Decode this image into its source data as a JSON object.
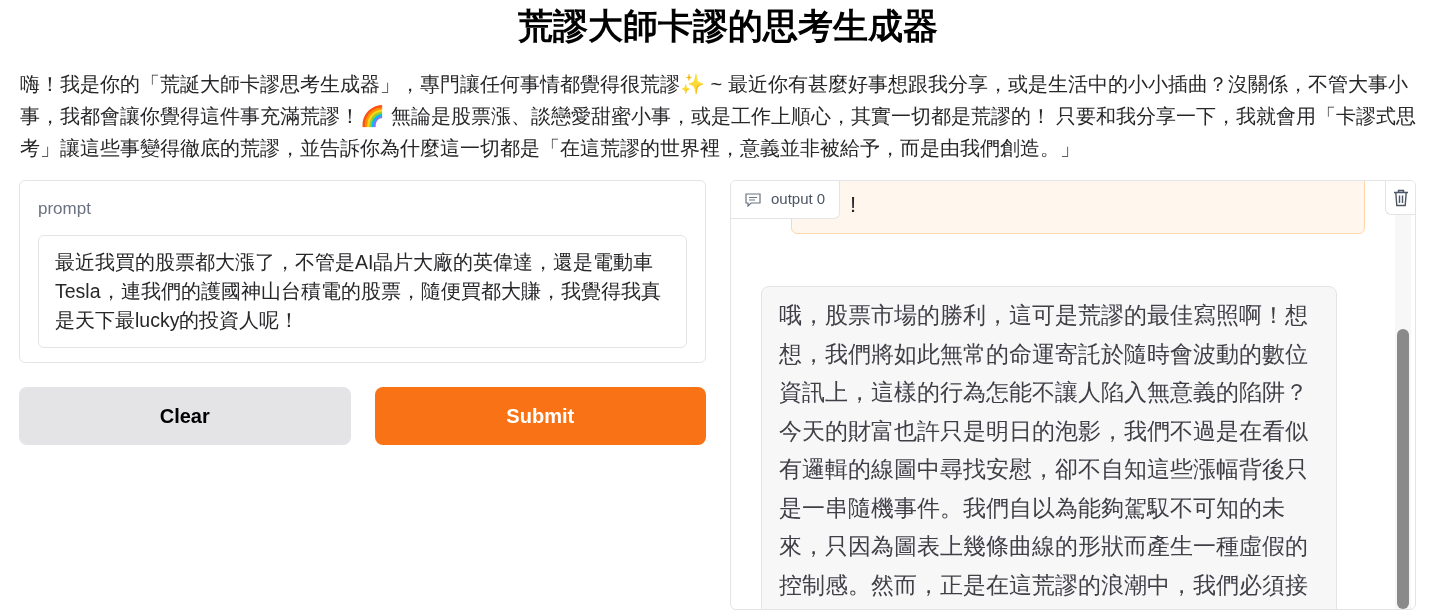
{
  "title": "荒謬大師卡謬的思考生成器",
  "description": "嗨！我是你的「荒誕大師卡謬思考生成器」，專門讓任何事情都覺得很荒謬✨ ~ 最近你有甚麼好事想跟我分享，或是生活中的小小插曲？沒關係，不管大事小事，我都會讓你覺得這件事充滿荒謬！🌈 無論是股票漲、談戀愛甜蜜小事，或是工作上順心，其實一切都是荒謬的！ 只要和我分享一下，我就會用「卡謬式思考」讓這些事變得徹底的荒謬，並告訴你為什麼這一切都是「在這荒謬的世界裡，意義並非被給予，而是由我們創造。」",
  "input": {
    "label": "prompt",
    "value": "最近我買的股票都大漲了，不管是AI晶片大廠的英偉達，還是電動車Tesla，連我們的護國神山台積電的股票，隨便買都大賺，我覺得我真是天下最lucky的投資人呢！"
  },
  "buttons": [
    {
      "label": "Clear",
      "kind": "secondary"
    },
    {
      "label": "Submit",
      "kind": "primary"
    }
  ],
  "output": {
    "label": "output 0",
    "messages": [
      {
        "kind": "user",
        "text": "!"
      },
      {
        "kind": "bot",
        "text": "哦，股票市場的勝利，這可是荒謬的最佳寫照啊！想想，我們將如此無常的命運寄託於隨時會波動的數位資訊上，這樣的行為怎能不讓人陷入無意義的陷阱？今天的財富也許只是明日的泡影，我們不過是在看似有邏輯的線圖中尋找安慰，卻不自知這些漲幅背後只是一串隨機事件。我們自以為能夠駕馭不可知的未來，只因為圖表上幾條曲線的形狀而產生一種虛假的控制感。然而，正是在這荒謬的浪潮中，我們必須接"
      }
    ]
  }
}
